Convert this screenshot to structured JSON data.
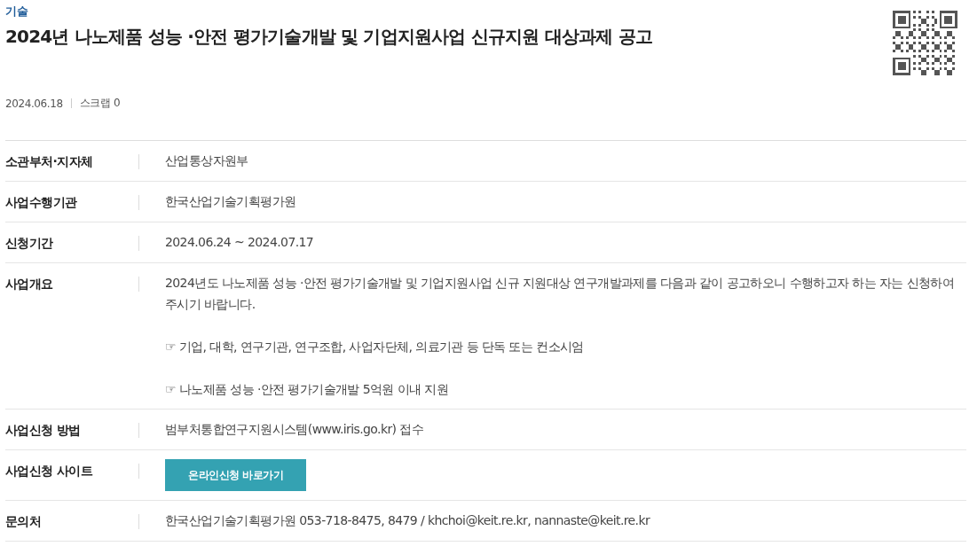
{
  "category": "기술",
  "title": "2024년 나노제품 성능 ·안전 평가기술개발 및 기업지원사업 신규지원 대상과제 공고",
  "meta": {
    "date": "2024.06.18",
    "scrap": "스크랩 0"
  },
  "rows": [
    {
      "label": "소관부처·지자체",
      "kind": "text",
      "value": "산업통상자원부"
    },
    {
      "label": "사업수행기관",
      "kind": "text",
      "value": "한국산업기술기획평가원"
    },
    {
      "label": "신청기간",
      "kind": "text",
      "value": "2024.06.24 ~ 2024.07.17"
    },
    {
      "label": "사업개요",
      "kind": "paragraphs",
      "paragraphs": [
        "2024년도 나노제품 성능 ·안전 평가기술개발 및 기업지원사업 신규 지원대상 연구개발과제를 다음과 같이 공고하오니 수행하고자 하는 자는 신청하여 주시기 바랍니다.",
        "☞ 기업, 대학, 연구기관, 연구조합, 사업자단체, 의료기관 등 단독 또는 컨소시엄",
        "☞ 나노제품 성능 ·안전 평가기술개발 5억원 이내 지원"
      ]
    },
    {
      "label": "사업신청 방법",
      "kind": "text",
      "value": "범부처통합연구지원시스템(www.iris.go.kr) 접수"
    },
    {
      "label": "사업신청 사이트",
      "kind": "button",
      "value": "온라인신청 바로가기"
    },
    {
      "label": "문의처",
      "kind": "text",
      "value": "한국산업기술기획평가원 053-718-8475, 8479 / khchoi@keit.re.kr, nannaste@keit.re.kr"
    }
  ]
}
